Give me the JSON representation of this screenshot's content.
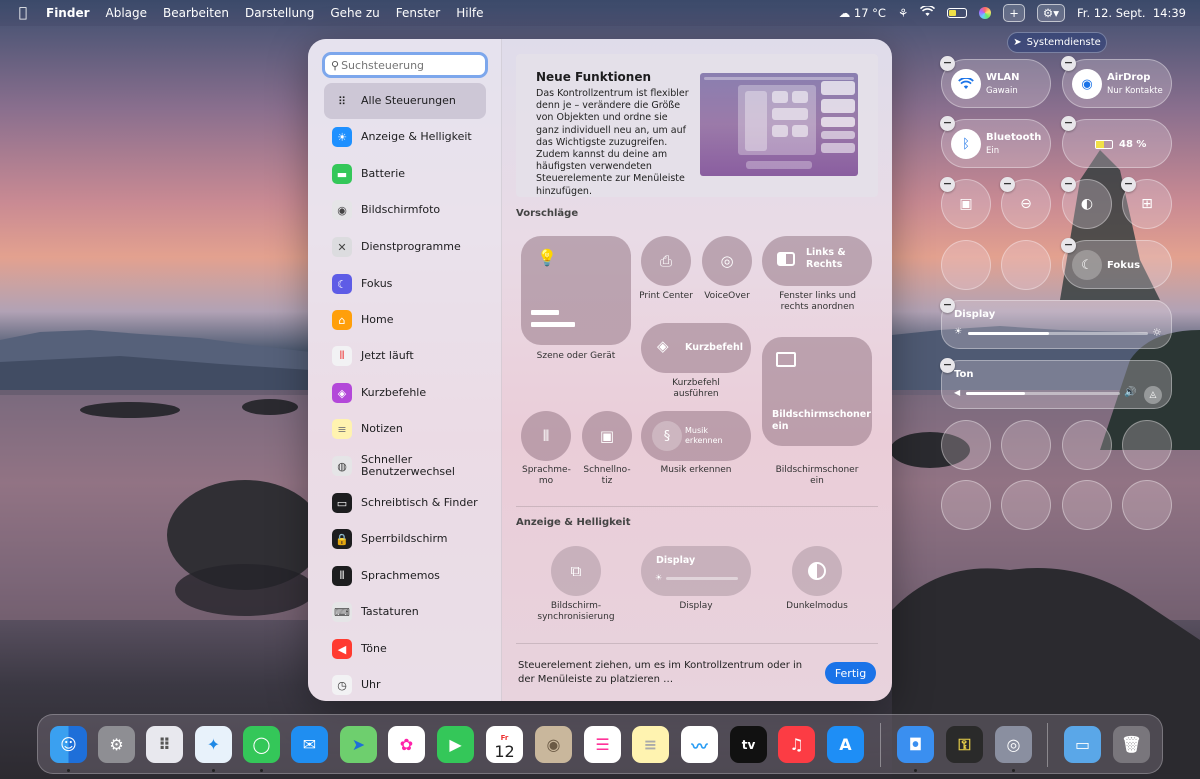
{
  "menubar": {
    "apple_icon": "apple-icon",
    "app_name": "Finder",
    "menus": [
      "Ablage",
      "Bearbeiten",
      "Darstellung",
      "Gehe zu",
      "Fenster",
      "Hilfe"
    ],
    "weather": "17 °C",
    "datetime": "Fr. 12. Sept.  14:39",
    "plus_label": "+"
  },
  "system_services": {
    "label": "Systemdienste"
  },
  "sidebar": {
    "search_placeholder": "Suchsteuerung",
    "items": [
      {
        "label": "Alle Steuerungen",
        "icon": "grid-icon",
        "color": "transparent"
      },
      {
        "label": "Anzeige & Helligkeit",
        "icon": "sun-icon",
        "color": "#1e90ff"
      },
      {
        "label": "Batterie",
        "icon": "battery-icon",
        "color": "#34c759"
      },
      {
        "label": "Bildschirmfoto",
        "icon": "camera-icon",
        "color": "#e5e5e7"
      },
      {
        "label": "Dienstprogramme",
        "icon": "tools-icon",
        "color": "#dcdcdf"
      },
      {
        "label": "Fokus",
        "icon": "moon-icon",
        "color": "#5e5ce6"
      },
      {
        "label": "Home",
        "icon": "home-icon",
        "color": "#ff9f0a"
      },
      {
        "label": "Jetzt läuft",
        "icon": "waveform-icon",
        "color": "#f2f2f4"
      },
      {
        "label": "Kurzbefehle",
        "icon": "shortcuts-icon",
        "color": "#b348d9"
      },
      {
        "label": "Notizen",
        "icon": "notes-icon",
        "color": "#fff3b0"
      },
      {
        "label": "Schneller Benutzerwechsel",
        "icon": "user-icon",
        "color": "#e5e5e7"
      },
      {
        "label": "Schreibtisch & Finder",
        "icon": "desktop-icon",
        "color": "#1d1d1f"
      },
      {
        "label": "Sperrbildschirm",
        "icon": "lock-icon",
        "color": "#1d1d1f"
      },
      {
        "label": "Sprachmemos",
        "icon": "voice-memo-icon",
        "color": "#1d1d1f"
      },
      {
        "label": "Tastaturen",
        "icon": "keyboard-icon",
        "color": "#e5e5e7"
      },
      {
        "label": "Töne",
        "icon": "speaker-icon",
        "color": "#ff3b30"
      },
      {
        "label": "Uhr",
        "icon": "clock-icon",
        "color": "#f2f2f4"
      }
    ]
  },
  "new_features": {
    "title": "Neue Funktionen",
    "text": "Das Kontrollzentrum ist flexibler denn je – verändere die Größe von Objekten und ordne sie ganz individuell neu an, um auf das Wichtigste zuzugreifen. Zudem kannst du deine am häufigsten verwendeten Steuerelemente zur Menüleiste hinzufügen."
  },
  "suggestions": {
    "title": "Vorschläge",
    "scene_label": "Szene oder Gerät",
    "print_center": "Print Center",
    "voiceover": "VoiceOver",
    "window_tile": "Links & Rechts",
    "window_label": "Fenster links und rechts anordnen",
    "shortcut_tile": "Kurzbefehl",
    "shortcut_label": "Kurzbefehl ausführen",
    "screensaver_tile": "Bildschirmschoner ein",
    "screensaver_label": "Bildschirmschoner ein",
    "voice_memo_label": "Sprachme- mo",
    "quick_note_label": "Schnellno- tiz",
    "music_tile": "Musik erkennen",
    "music_label": "Musik erkennen"
  },
  "display_section": {
    "title": "Anzeige & Helligkeit",
    "sync_label": "Bildschirm- synchronisierung",
    "display_tile": "Display",
    "display_label": "Display",
    "dark_label": "Dunkelmodus",
    "display_level": 0.0
  },
  "footer": {
    "text": "Steuerelement ziehen, um es im Kontrollzentrum oder in der Menüleiste zu platzieren …",
    "done_label": "Fertig"
  },
  "control_center": {
    "wlan_title": "WLAN",
    "wlan_sub": "Gawain",
    "airdrop_title": "AirDrop",
    "airdrop_sub": "Nur Kontakte",
    "bluetooth_title": "Bluetooth",
    "bluetooth_sub": "Ein",
    "battery_text": "48 %",
    "battery_level": 0.48,
    "focus_label": "Fokus",
    "display_label": "Display",
    "display_level": 0.45,
    "sound_label": "Ton",
    "sound_level": 0.38
  },
  "dock": {
    "apps": [
      "Finder",
      "Systemeinstellungen",
      "Launchpad",
      "Safari",
      "Nachrichten",
      "Mail",
      "Karten",
      "Fotos",
      "FaceTime",
      "Kalender",
      "Kontakte",
      "Erinnerungen",
      "Notizen",
      "Freeform",
      "TV",
      "Musik",
      "App Store"
    ],
    "calendar_month": "Fr",
    "calendar_day": "12",
    "tv_label": "tv"
  }
}
